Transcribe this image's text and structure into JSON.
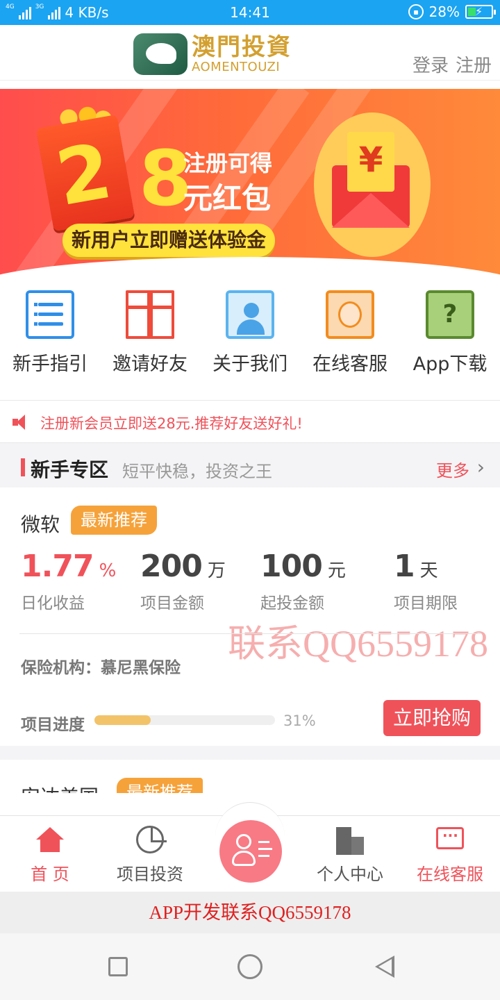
{
  "status_bar": {
    "net_type": "4G",
    "net_type2": "3G",
    "speed": "4 KB/s",
    "time": "14:41",
    "battery": "28%"
  },
  "header": {
    "logo_cn": "澳門投資",
    "logo_en": "AOMENTOUZI",
    "login": "登录",
    "register": "注册"
  },
  "banner": {
    "digit_left": "2",
    "digit_right": "8",
    "line1": "注册可得",
    "line2": "元红包",
    "pill": "新用户立即赠送体验金",
    "currency": "¥",
    "slide_count": 4,
    "active_slide": 1
  },
  "quick_menu": [
    {
      "label": "新手指引",
      "icon": "guide-list-icon"
    },
    {
      "label": "邀请好友",
      "icon": "gift-icon"
    },
    {
      "label": "关于我们",
      "icon": "people-icon"
    },
    {
      "label": "在线客服",
      "icon": "service-agent-icon"
    },
    {
      "label": "App下载",
      "icon": "question-icon"
    }
  ],
  "notice": {
    "text": "注册新会员立即送28元.推荐好友送好礼!"
  },
  "section": {
    "title": "新手专区",
    "subtitle": "短平快稳，投资之王",
    "more": "更多"
  },
  "product": {
    "name": "微软",
    "tag": "最新推荐",
    "rate_value": "1.77",
    "rate_unit": "%",
    "rate_label": "日化收益",
    "amount_value": "200",
    "amount_unit": "万",
    "amount_label": "项目金额",
    "min_value": "100",
    "min_unit": "元",
    "min_label": "起投金额",
    "term_value": "1",
    "term_unit": "天",
    "term_label": "项目期限",
    "insurer": "保险机构：慕尼黑保险",
    "progress_label": "项目进度",
    "progress_percent": 31,
    "progress_text": "31%",
    "buy_label": "立即抢购",
    "watermark": "联系QQ6559178"
  },
  "product2": {
    "name": "安达美国",
    "tag": "最新推荐"
  },
  "tabbar": {
    "home": "首 页",
    "invest": "项目投资",
    "personal": "个人中心",
    "service": "在线客服"
  },
  "ad_bar": {
    "text": "APP开发联系QQ6559178"
  },
  "colors": {
    "status_bar": "#1ba4f2",
    "accent": "#f0525a",
    "tag": "#f6a23a",
    "logo": "#d3a030",
    "progress": "#f3c36a"
  }
}
